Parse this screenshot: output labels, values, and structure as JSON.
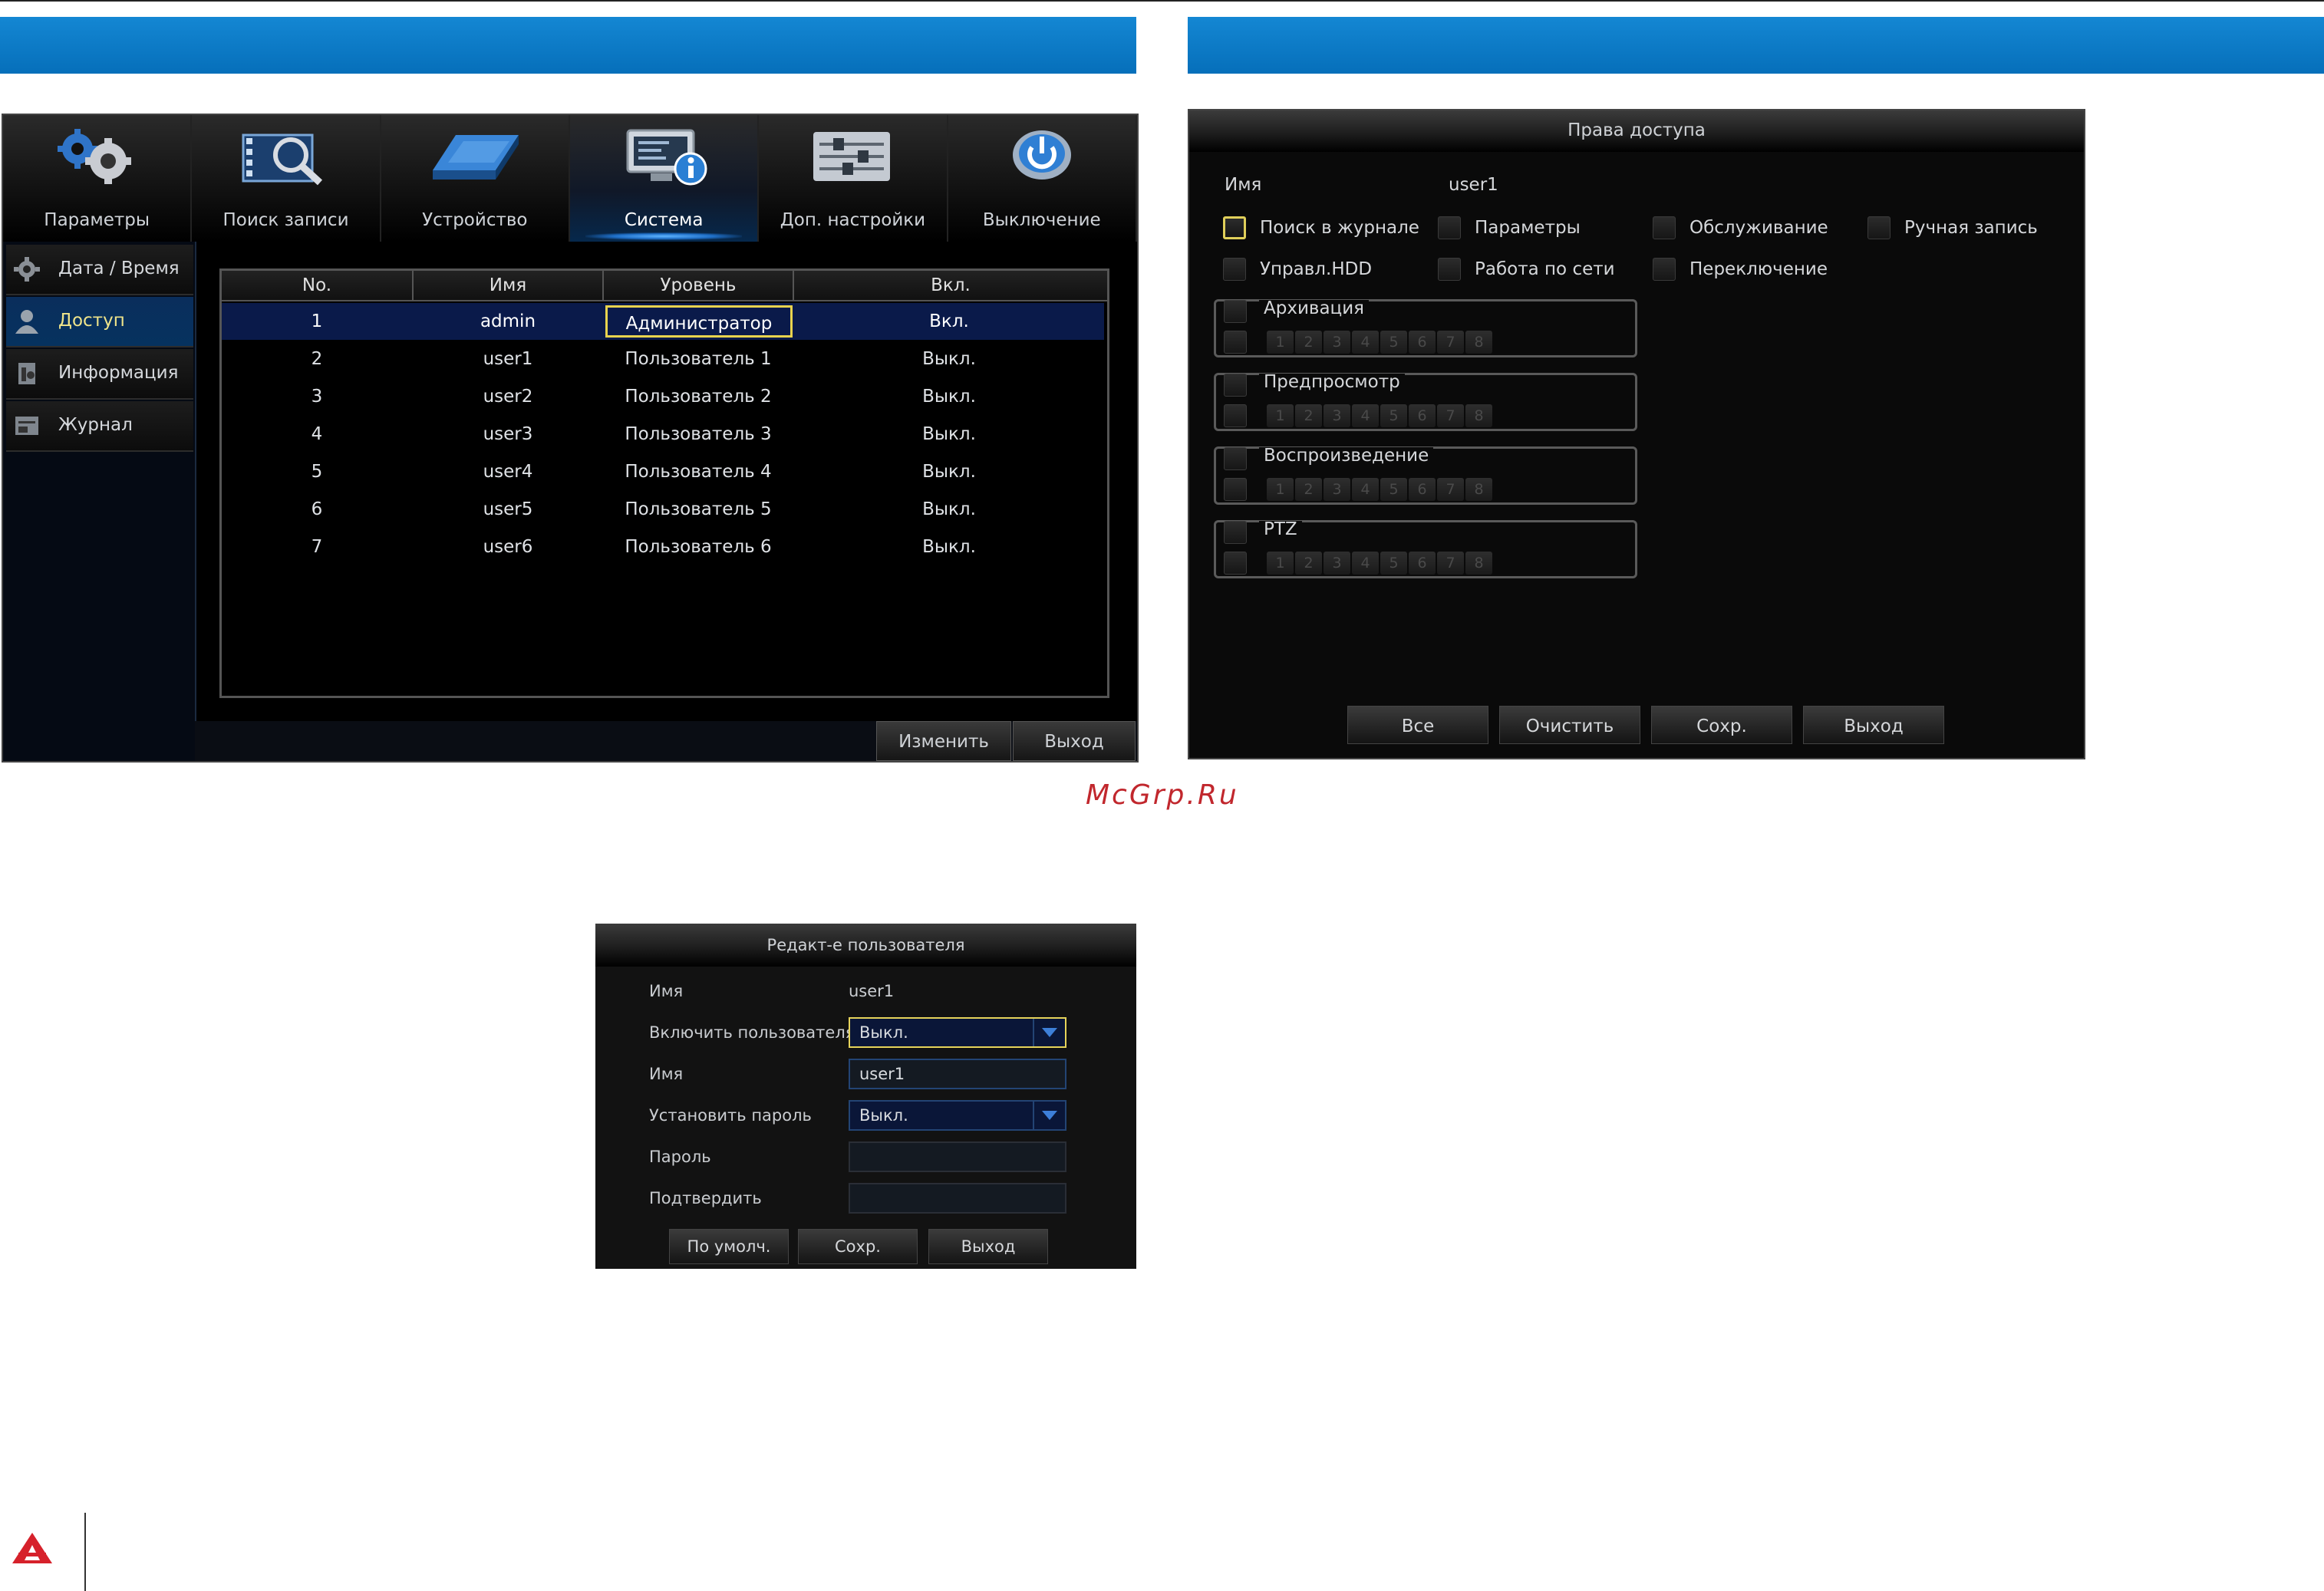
{
  "colors": {
    "header_blue": "#0a78c4",
    "accent_yellow": "#e8d34e",
    "watermark_red": "#c1272d"
  },
  "screen1": {
    "tabs": [
      {
        "label": "Параметры",
        "icon": "gears-icon"
      },
      {
        "label": "Поиск записи",
        "icon": "film-search-icon"
      },
      {
        "label": "Устройство",
        "icon": "hard-drive-icon"
      },
      {
        "label": "Система",
        "icon": "monitor-info-icon"
      },
      {
        "label": "Доп. настройки",
        "icon": "sliders-icon"
      },
      {
        "label": "Выключение",
        "icon": "power-icon"
      }
    ],
    "active_tab": "Система",
    "sidebar": [
      {
        "label": "Дата / Время",
        "icon": "gear-icon"
      },
      {
        "label": "Доступ",
        "icon": "user-icon"
      },
      {
        "label": "Информация",
        "icon": "info-icon"
      },
      {
        "label": "Журнал",
        "icon": "log-icon"
      }
    ],
    "active_sidebar": "Доступ",
    "table": {
      "headers": [
        "No.",
        "Имя",
        "Уровень",
        "Вкл."
      ],
      "rows": [
        [
          "1",
          "admin",
          "Администратор",
          "Вкл."
        ],
        [
          "2",
          "user1",
          "Пользователь 1",
          "Выкл."
        ],
        [
          "3",
          "user2",
          "Пользователь 2",
          "Выкл."
        ],
        [
          "4",
          "user3",
          "Пользователь 3",
          "Выкл."
        ],
        [
          "5",
          "user4",
          "Пользователь 4",
          "Выкл."
        ],
        [
          "6",
          "user5",
          "Пользователь 5",
          "Выкл."
        ],
        [
          "7",
          "user6",
          "Пользователь 6",
          "Выкл."
        ]
      ]
    },
    "buttons": {
      "edit": "Изменить",
      "exit": "Выход"
    }
  },
  "screen2": {
    "title": "Права доступа",
    "name_label": "Имя",
    "name_value": "user1",
    "perms_row1": [
      "Поиск в журнале",
      "Параметры",
      "Обслуживание",
      "Ручная запись"
    ],
    "perms_row2": [
      "Управл.HDD",
      "Работа по сети",
      "Переключение"
    ],
    "groups": [
      "Архивация",
      "Предпросмотр",
      "Воспроизведение",
      "PTZ"
    ],
    "channels": [
      "1",
      "2",
      "3",
      "4",
      "5",
      "6",
      "7",
      "8"
    ],
    "buttons": {
      "all": "Все",
      "clear": "Очистить",
      "save": "Сохр.",
      "exit": "Выход"
    }
  },
  "screen3": {
    "title": "Редакт-е пользователя",
    "name_label": "Имя",
    "name_value": "user1",
    "enable_label": "Включить пользователя",
    "enable_value": "Выкл.",
    "username_label": "Имя",
    "username_value": "user1",
    "setpass_label": "Установить пароль",
    "setpass_value": "Выкл.",
    "password_label": "Пароль",
    "confirm_label": "Подтвердить",
    "buttons": {
      "default": "По умолч.",
      "save": "Сохр.",
      "exit": "Выход"
    }
  },
  "watermark": "McGrp.Ru"
}
